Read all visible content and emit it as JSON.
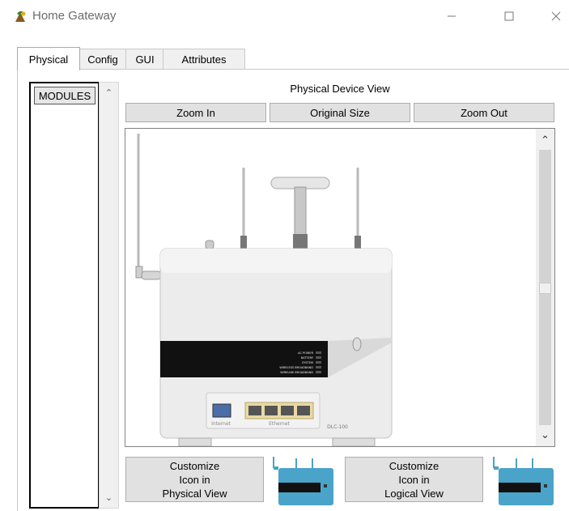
{
  "window": {
    "title": "Home Gateway"
  },
  "tabs": [
    {
      "label": "Physical",
      "active": true
    },
    {
      "label": "Config"
    },
    {
      "label": "GUI"
    },
    {
      "label": "Attributes"
    }
  ],
  "modules": {
    "label": "MODULES"
  },
  "device_view": {
    "title": "Physical Device View",
    "zoom_in": "Zoom In",
    "original_size": "Original Size",
    "zoom_out": "Zoom Out",
    "labels": {
      "led1": "AC POWER",
      "led2": "BATTERY",
      "led3": "SYSTEM",
      "led4": "WIRELESS BROADBAND",
      "led5": "WIRELINE BROADBAND",
      "port_internet": "Internet",
      "port_ethernet": "Ethernet",
      "model": "DLC-100"
    }
  },
  "customize": {
    "physical": {
      "line1": "Customize",
      "line2": "Icon in",
      "line3": "Physical View"
    },
    "logical": {
      "line1": "Customize",
      "line2": "Icon in",
      "line3": "Logical View"
    }
  },
  "colors": {
    "accent": "#e1e1e1",
    "device_band": "#111111",
    "thumb_teal": "#4aa3c8"
  }
}
